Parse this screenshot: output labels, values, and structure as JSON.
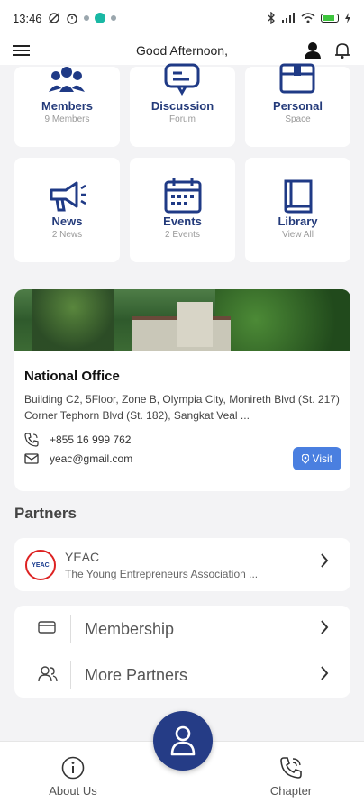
{
  "status_bar": {
    "time": "13:46"
  },
  "header": {
    "greeting": "Good Afternoon,"
  },
  "tiles": [
    {
      "title": "Members",
      "subtitle": "9 Members",
      "icon": "members-icon"
    },
    {
      "title": "Discussion",
      "subtitle": "Forum",
      "icon": "discussion-icon"
    },
    {
      "title": "Personal",
      "subtitle": "Space",
      "icon": "personal-box-icon"
    },
    {
      "title": "News",
      "subtitle": "2 News",
      "icon": "megaphone-icon"
    },
    {
      "title": "Events",
      "subtitle": "2 Events",
      "icon": "calendar-icon"
    },
    {
      "title": "Library",
      "subtitle": "View All",
      "icon": "book-icon"
    }
  ],
  "office": {
    "name": "National Office",
    "address": "Building C2, 5Floor, Zone B, Olympia City, Monireth Blvd (St. 217) Corner Tephorn Blvd (St. 182), Sangkat Veal ...",
    "phone": "+855 16 999 762",
    "email": "yeac@gmail.com",
    "visit_label": "Visit"
  },
  "partners": {
    "section_title": "Partners",
    "items": [
      {
        "name": "YEAC",
        "description": "The Young Entrepreneurs Association ...",
        "logo_text": "YEAC"
      }
    ]
  },
  "menu": [
    {
      "label": "Membership",
      "icon": "card-icon"
    },
    {
      "label": "More Partners",
      "icon": "users-icon"
    }
  ],
  "bottom_nav": {
    "about_label": "About Us",
    "chapter_label": "Chapter"
  },
  "colors": {
    "brand": "#253c86",
    "accent": "#4a7fe0",
    "background": "#f3f3f5"
  }
}
